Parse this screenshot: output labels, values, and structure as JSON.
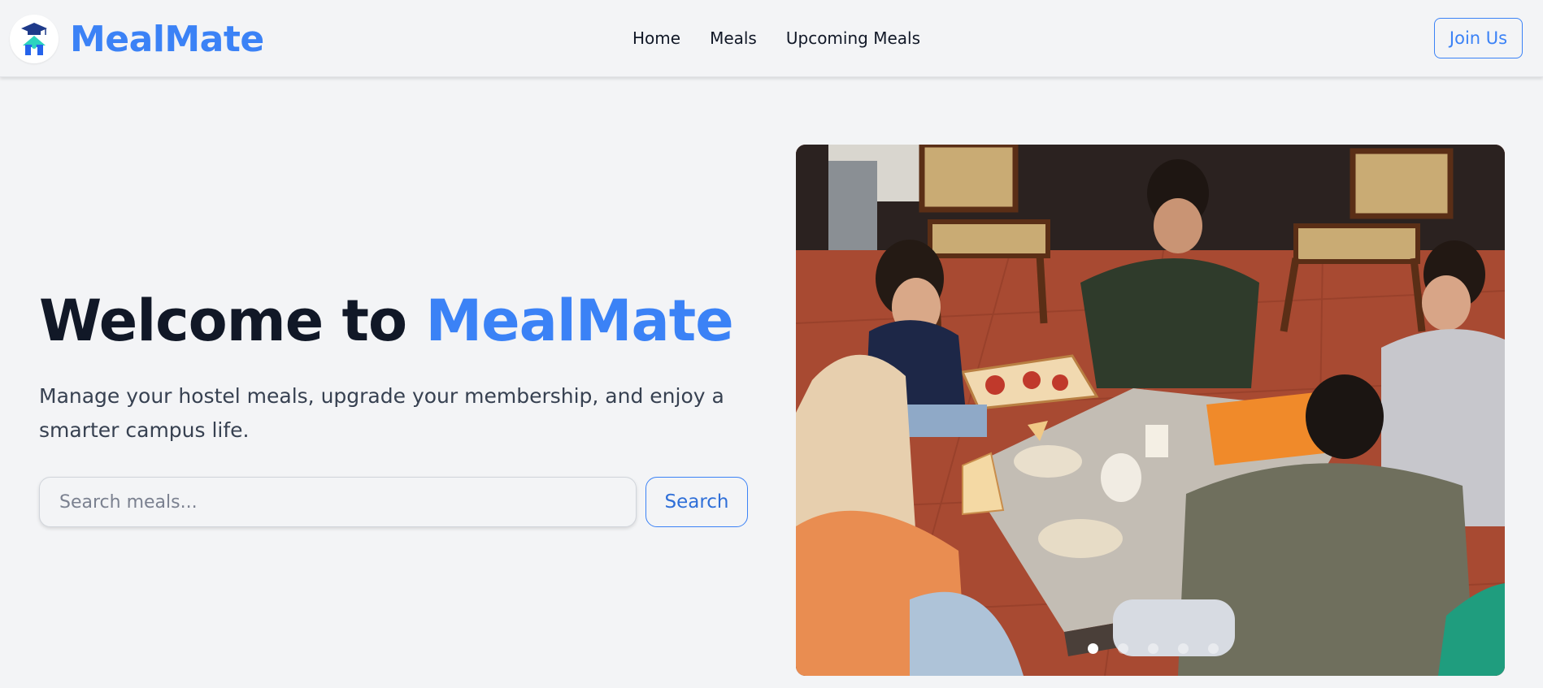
{
  "brand": {
    "name": "MealMate",
    "logo_icon": "graduation-cap-house-icon",
    "accent_color": "#3b82f6"
  },
  "nav": {
    "links": [
      {
        "label": "Home"
      },
      {
        "label": "Meals"
      },
      {
        "label": "Upcoming Meals"
      }
    ],
    "join_label": "Join Us"
  },
  "hero": {
    "title_prefix": "Welcome to ",
    "title_accent": "MealMate",
    "subtitle": "Manage your hostel meals, upgrade your membership, and enjoy a smarter campus life.",
    "search": {
      "placeholder": "Search meals...",
      "button_label": "Search"
    }
  },
  "carousel": {
    "slide_count": 5,
    "active_index": 0,
    "slide_icon": "friends-sharing-pizza-photo"
  }
}
